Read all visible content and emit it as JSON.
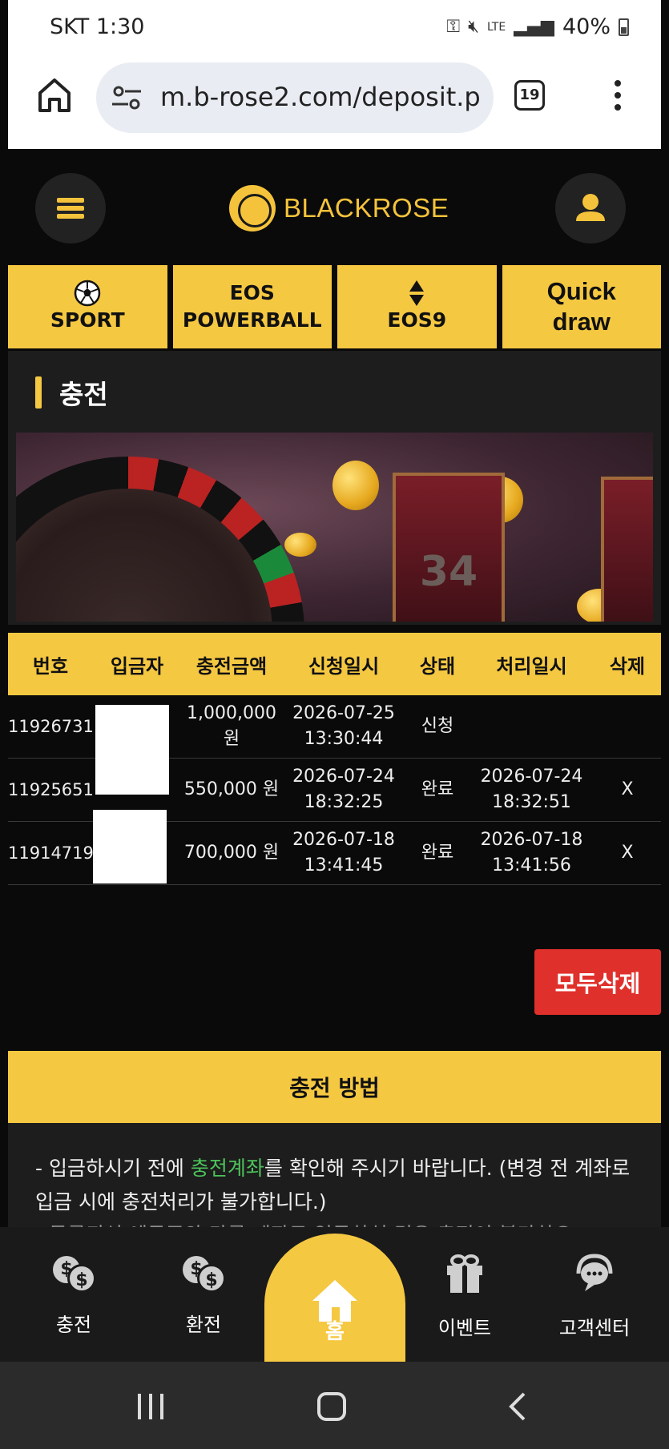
{
  "status_bar": {
    "carrier_time": "SKT 1:30",
    "network": "LTE",
    "battery": "40%"
  },
  "browser": {
    "url": "m.b-rose2.com/deposit.p",
    "tab_count": "19"
  },
  "header": {
    "brand": "BLACKROSE"
  },
  "game_nav": [
    {
      "line1": "",
      "line2": "SPORT",
      "icon": "soccer-ball-icon"
    },
    {
      "line1": "EOS",
      "line2": "POWERBALL",
      "icon": ""
    },
    {
      "line1": "",
      "line2": "EOS9",
      "icon": "updown-arrows-icon"
    },
    {
      "line1": "Quick",
      "line2": "draw",
      "icon": ""
    }
  ],
  "page": {
    "title": "충전"
  },
  "banner": {
    "door_number": "34"
  },
  "table": {
    "headers": [
      "번호",
      "입금자",
      "충전금액",
      "신청일시",
      "상태",
      "처리일시",
      "삭제"
    ],
    "rows": [
      {
        "id": "11926731",
        "depositor": "",
        "amount": "1,000,000 원",
        "requested": "2026-07-25 13:30:44",
        "status": "신청",
        "processed": "",
        "delete": ""
      },
      {
        "id": "11925651",
        "depositor": "",
        "amount": "550,000 원",
        "requested": "2026-07-24 18:32:25",
        "status": "완료",
        "processed": "2026-07-24 18:32:51",
        "delete": "X"
      },
      {
        "id": "11914719",
        "depositor": "",
        "amount": "700,000 원",
        "requested": "2026-07-18 13:41:45",
        "status": "완료",
        "processed": "2026-07-18 13:41:56",
        "delete": "X"
      }
    ]
  },
  "delete_all_label": "모두삭제",
  "howto": {
    "title": "충전 방법",
    "text_before": "- 입금하시기 전에 ",
    "highlight": "충전계좌",
    "text_after": "를 확인해 주시기 바랍니다. (변경 전 계좌로 입금 시에 충전처리가 불가합니다.)",
    "cut_line": "- 등록되신 예금주와 다른 계좌로 입금하실 경우 충전이 불가하오"
  },
  "bottom_nav": {
    "charge": "충전",
    "exchange": "환전",
    "home": "홈",
    "event": "이벤트",
    "support": "고객센터"
  },
  "colors": {
    "accent": "#f5c842",
    "danger": "#e0302b",
    "highlight": "#4cc35a"
  }
}
